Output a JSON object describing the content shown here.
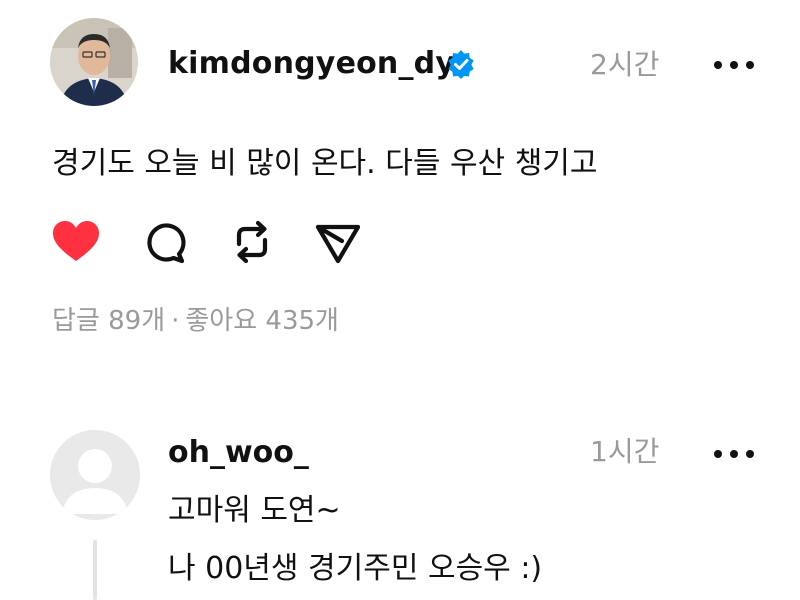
{
  "post": {
    "username": "kimdongyeon_dy",
    "verified": true,
    "time": "2시간",
    "text": "경기도 오늘 비 많이 온다. 다들 우산 챙기고",
    "liked": true,
    "stats": {
      "replies": "답글 89개",
      "separator": "·",
      "likes": "좋아요 435개"
    }
  },
  "reply": {
    "username": "oh_woo_",
    "time": "1시간",
    "lines": [
      "고마워 도연~",
      "나 00년생 경기주민 오승우 :)"
    ]
  },
  "colors": {
    "like": "#ff3040",
    "verified": "#0095f6",
    "muted": "#9a9a9a",
    "text": "#111111"
  },
  "icons": {
    "more": "more-icon",
    "like": "heart-icon",
    "comment": "comment-icon",
    "repost": "repost-icon",
    "share": "share-icon",
    "verified": "verified-badge-icon"
  }
}
